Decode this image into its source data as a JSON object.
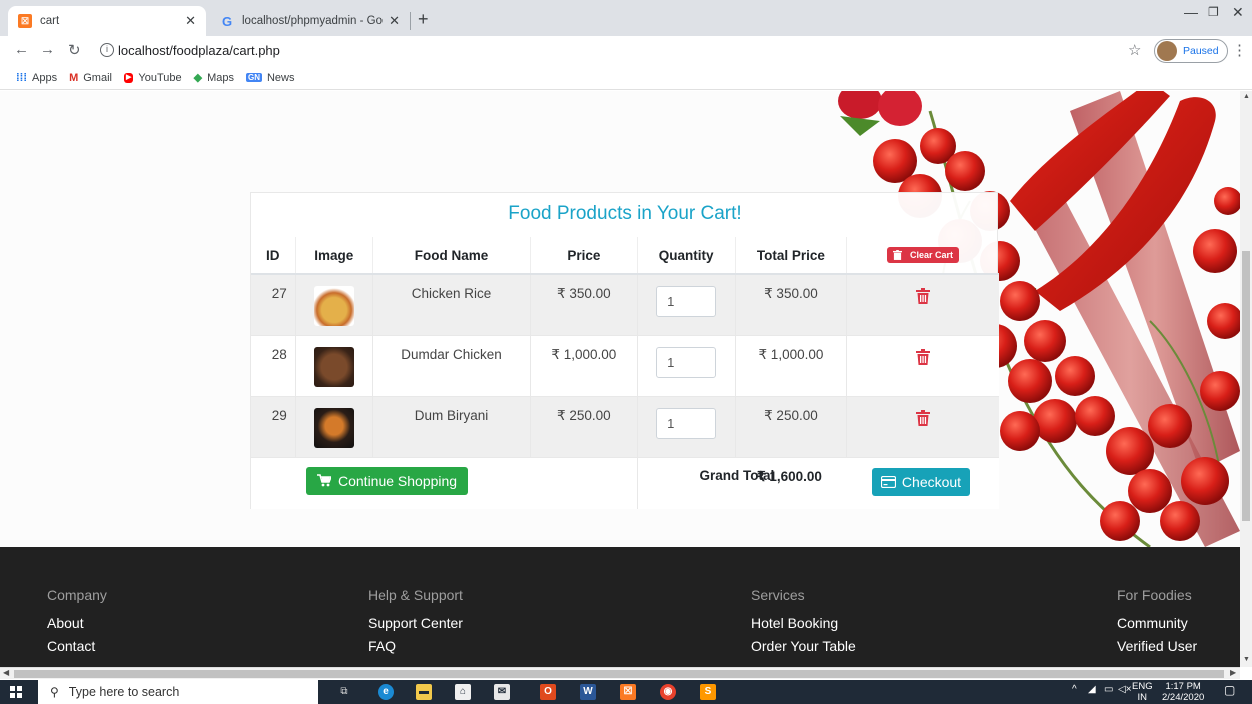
{
  "browser": {
    "tabs": [
      {
        "title": "cart",
        "active": true
      },
      {
        "title": "localhost/phpmyadmin - Google",
        "active": false
      }
    ],
    "url": "localhost/foodplaza/cart.php",
    "profile_label": "Paused",
    "bookmarks": [
      "Apps",
      "Gmail",
      "YouTube",
      "Maps",
      "News"
    ]
  },
  "cart": {
    "title": "Food Products in Your Cart!",
    "columns": [
      "ID",
      "Image",
      "Food Name",
      "Price",
      "Quantity",
      "Total Price"
    ],
    "clear_label": "Clear Cart",
    "items": [
      {
        "id": "27",
        "name": "Chicken Rice",
        "price": "₹ 350.00",
        "qty": "1",
        "total": "₹ 350.00"
      },
      {
        "id": "28",
        "name": "Dumdar Chicken",
        "price": "₹ 1,000.00",
        "qty": "1",
        "total": "₹ 1,000.00"
      },
      {
        "id": "29",
        "name": "Dum Biryani",
        "price": "₹ 250.00",
        "qty": "1",
        "total": "₹ 250.00"
      }
    ],
    "continue_label": "Continue Shopping",
    "grand_total_label": "Grand Total",
    "grand_total_value": "₹ 1,600.00",
    "checkout_label": "Checkout"
  },
  "footer": {
    "columns": [
      {
        "heading": "Company",
        "links": [
          "About",
          "Contact"
        ]
      },
      {
        "heading": "Help & Support",
        "links": [
          "Support Center",
          "FAQ"
        ]
      },
      {
        "heading": "Services",
        "links": [
          "Hotel Booking",
          "Order Your Table"
        ]
      },
      {
        "heading": "For Foodies",
        "links": [
          "Community",
          "Verified User"
        ]
      }
    ]
  },
  "taskbar": {
    "search_placeholder": "Type here to search",
    "lang_top": "ENG",
    "lang_bottom": "IN",
    "time": "1:17 PM",
    "date": "2/24/2020"
  },
  "colors": {
    "accent_title": "#1aa3c8",
    "danger": "#dc3545",
    "success": "#28a745",
    "info": "#17a2b8",
    "footer_bg": "#212121"
  }
}
